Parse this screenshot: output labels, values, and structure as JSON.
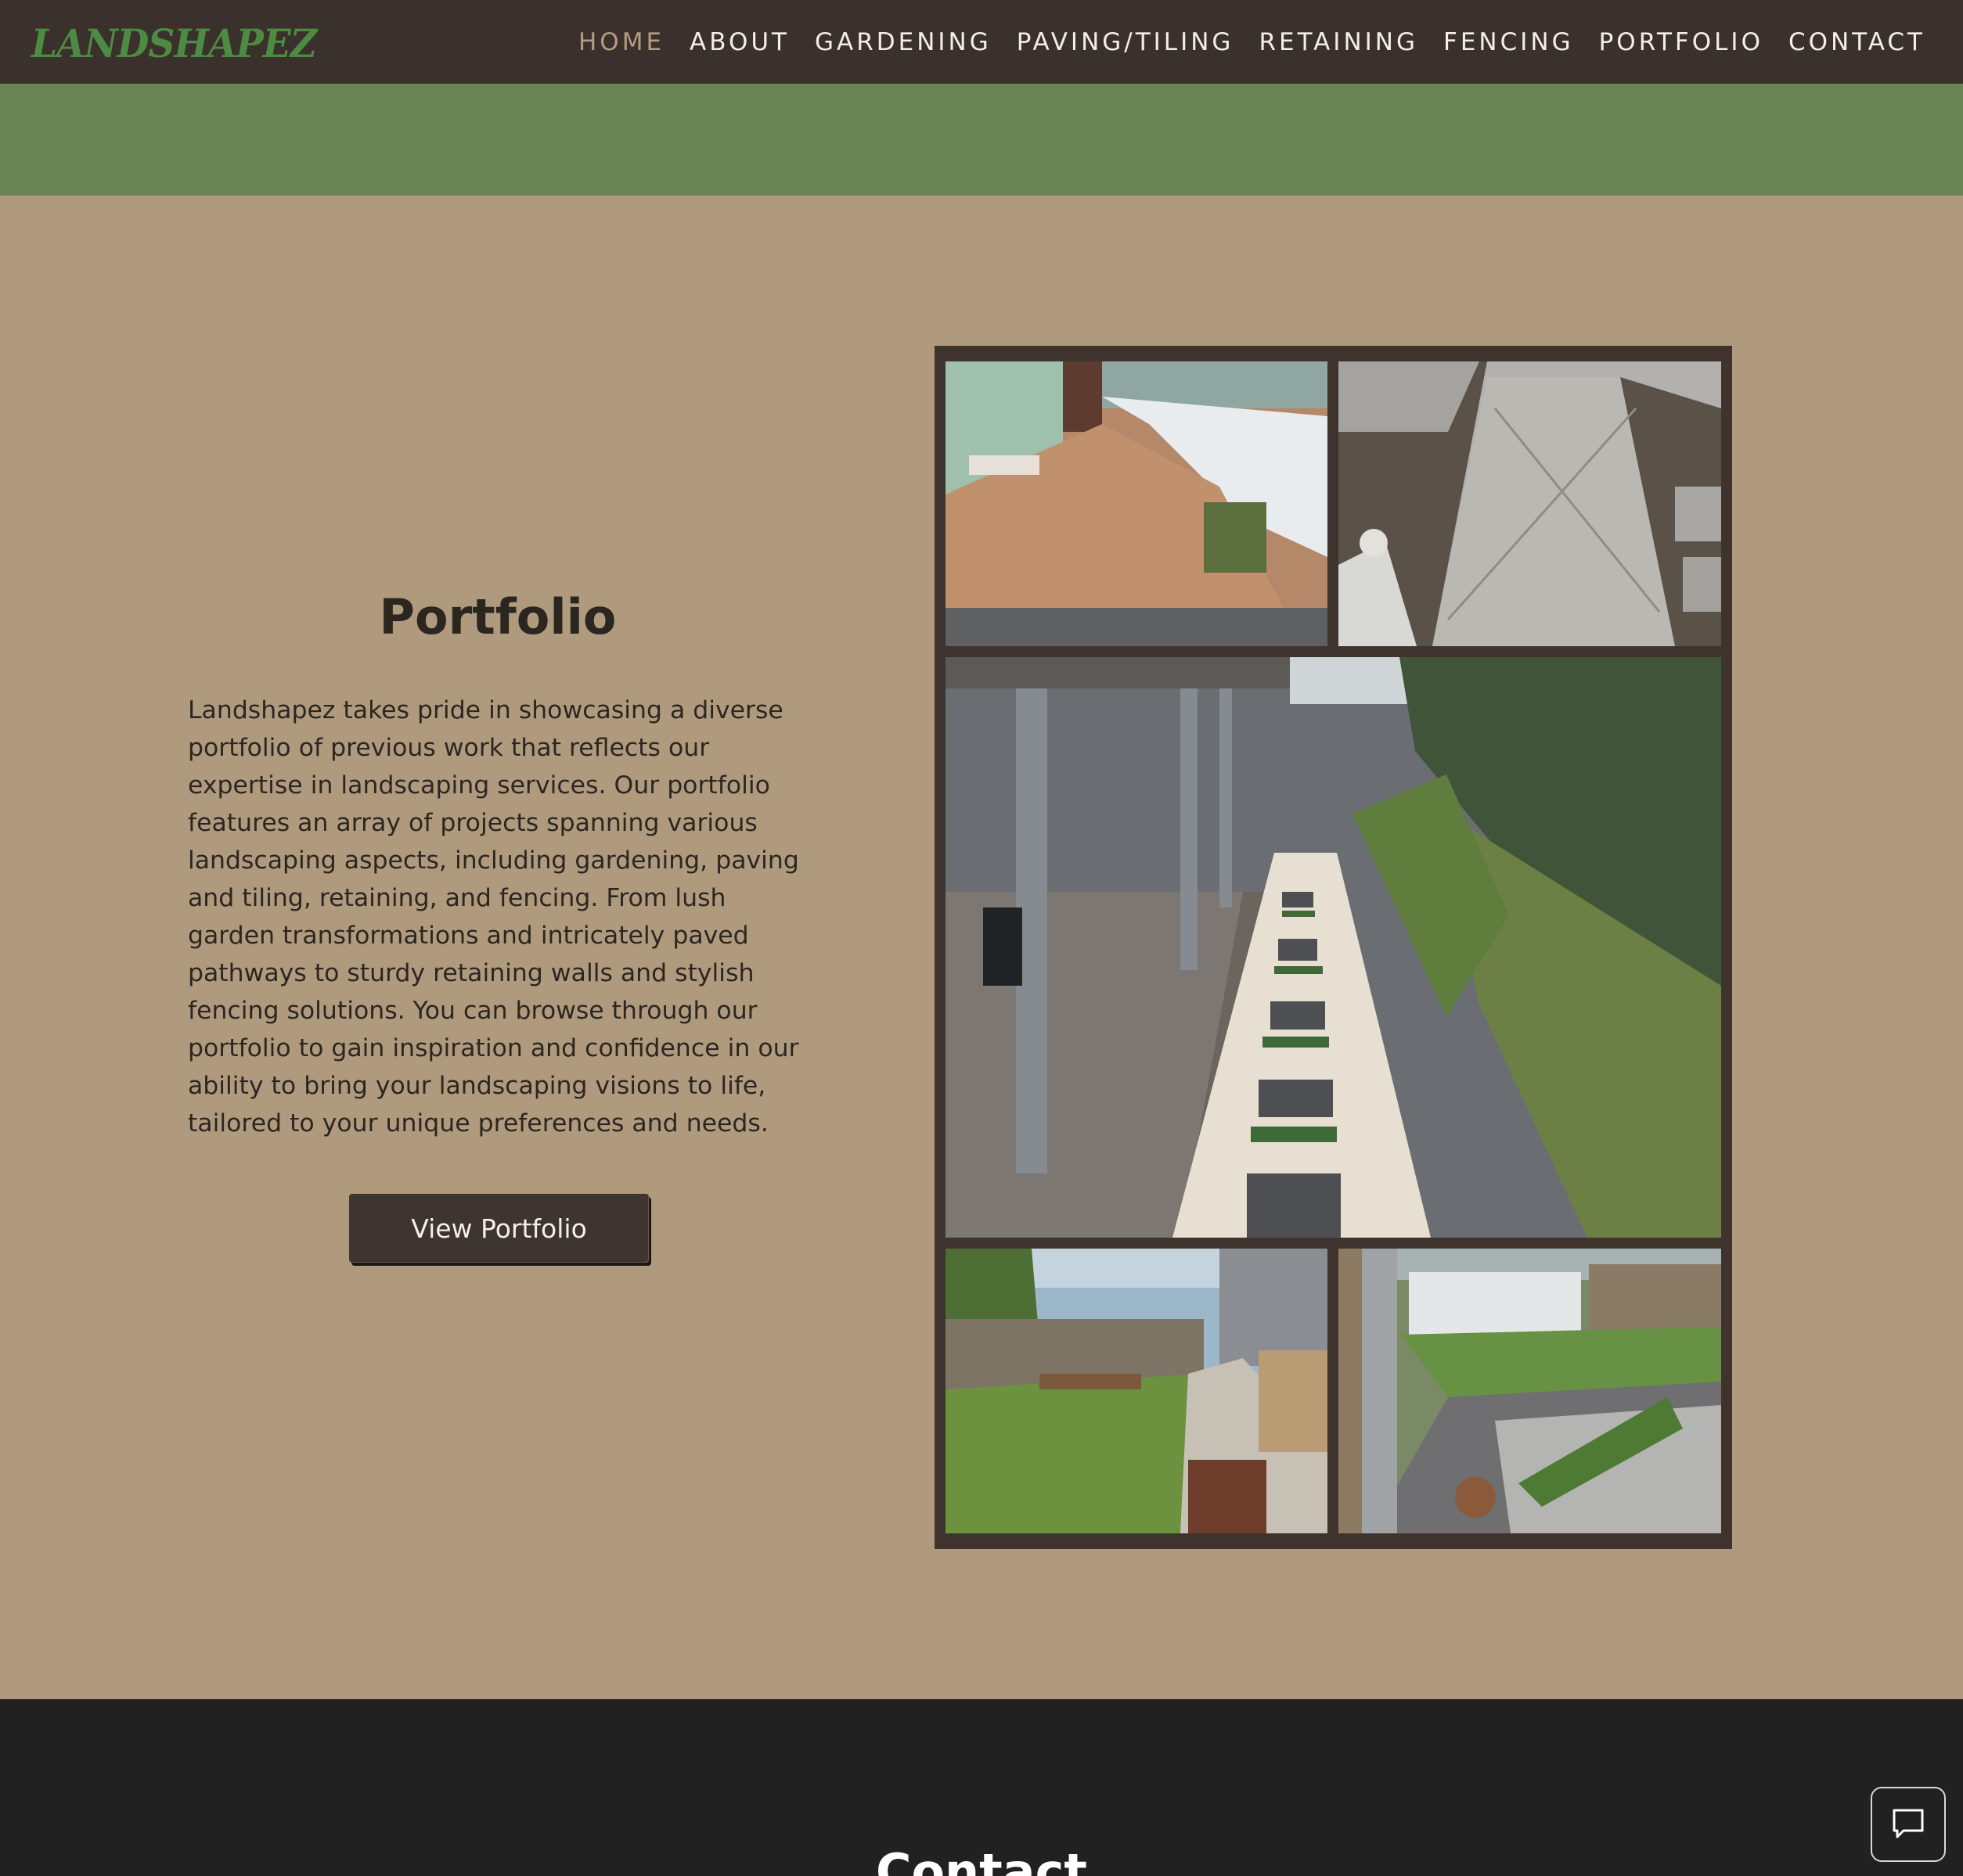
{
  "header": {
    "logo": "LANDSHAPEZ",
    "nav": [
      {
        "label": "HOME",
        "active": true
      },
      {
        "label": "ABOUT"
      },
      {
        "label": "GARDENING"
      },
      {
        "label": "PAVING/TILING"
      },
      {
        "label": "RETAINING"
      },
      {
        "label": "FENCING"
      },
      {
        "label": "PORTFOLIO"
      },
      {
        "label": "CONTACT"
      }
    ]
  },
  "portfolio": {
    "title": "Portfolio",
    "body": "Landshapez takes pride in showcasing a diverse portfolio of previous work that reflects our expertise in landscaping services. Our portfolio features an array of projects spanning various landscaping aspects, including gardening, paving and tiling, retaining, and fencing. From lush garden transformations and intricately paved pathways to sturdy retaining walls and stylish fencing solutions. You can browse through our portfolio to gain inspiration and confidence in our ability to bring your landscaping visions to life, tailored to your unique preferences and needs.",
    "button_label": "View Portfolio"
  },
  "contact": {
    "title": "Contact"
  },
  "icons": {
    "chat": "chat-bubble-icon"
  },
  "colors": {
    "header_bg": "#3b312c",
    "logo": "#4e8b42",
    "nav_active": "#b29c82",
    "band": "#6a8456",
    "page_bg": "#b09a7e",
    "button_bg": "#3e3430",
    "footer_bg": "#212121"
  }
}
